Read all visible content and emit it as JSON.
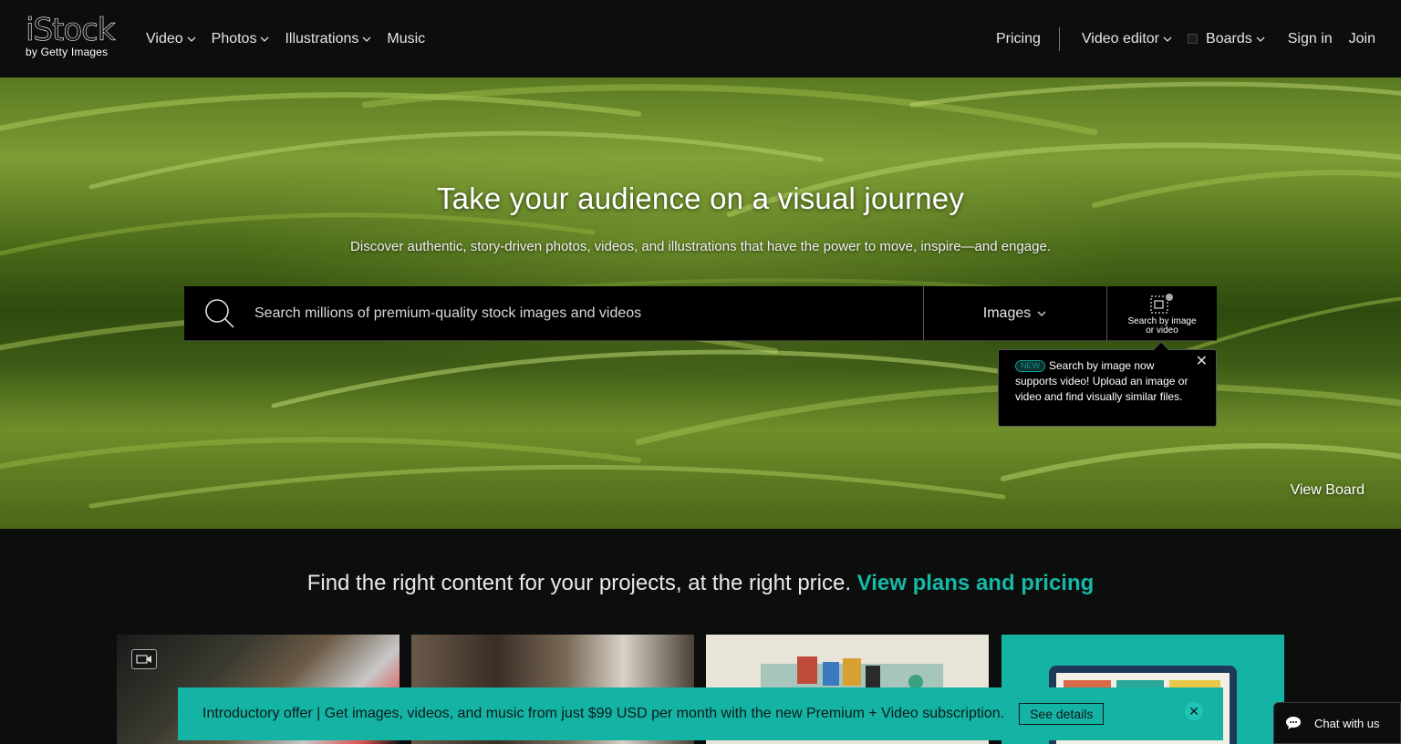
{
  "header": {
    "logo_brand": "iStock",
    "logo_sub": "by Getty Images",
    "nav_left": [
      {
        "label": "Video",
        "dropdown": true
      },
      {
        "label": "Photos",
        "dropdown": true
      },
      {
        "label": "Illustrations",
        "dropdown": true
      },
      {
        "label": "Music",
        "dropdown": false
      }
    ],
    "pricing": "Pricing",
    "video_editor": "Video editor",
    "boards": "Boards",
    "sign_in": "Sign in",
    "join": "Join"
  },
  "hero": {
    "title": "Take your audience on a visual journey",
    "subtitle": "Discover authentic, story-driven photos, videos, and illustrations that have the power to move, inspire—and engage.",
    "search_placeholder": "Search millions of premium-quality stock images and videos",
    "search_type": "Images",
    "search_by_image": "Search by image or video",
    "view_board": "View Board"
  },
  "tooltip": {
    "badge": "NEW",
    "text": "Search by image now supports video! Upload an image or video and find visually similar files.",
    "close": "✕"
  },
  "pricing_line": {
    "text": "Find the right content for your projects, at the right price.",
    "link": "View plans and pricing"
  },
  "offer_banner": {
    "text": "Introductory offer | Get images, videos, and music from just $99 USD per month with the new Premium + Video subscription.",
    "button": "See details",
    "close": "✕"
  },
  "chat": {
    "label": "Chat with us"
  },
  "colors": {
    "accent": "#14b3a3",
    "background": "#0c0d0d"
  }
}
